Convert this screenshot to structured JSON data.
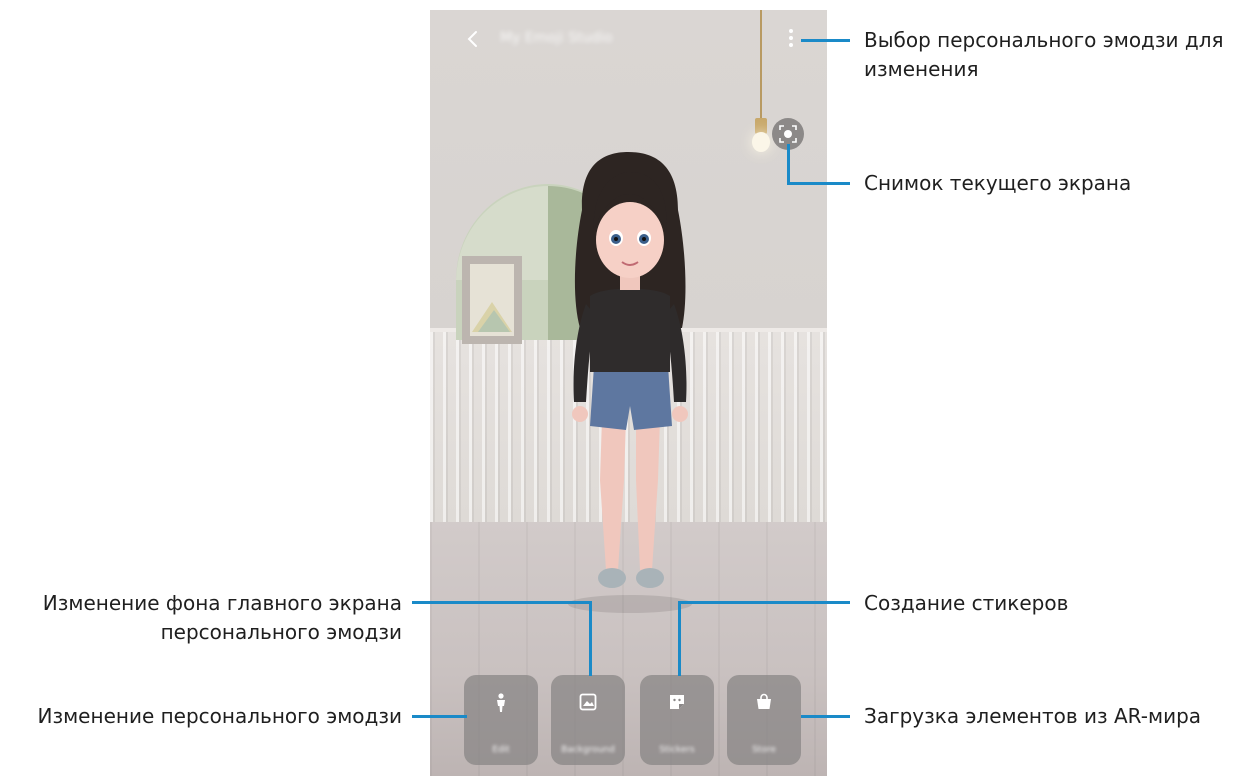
{
  "app": {
    "title": "My Emoji Studio"
  },
  "toolbar": {
    "back_icon": "chevron-left-icon",
    "more_icon": "more-vertical-icon",
    "capture_icon": "capture-screen-icon"
  },
  "menu": {
    "items": [
      {
        "label": "Edit",
        "icon": "person-icon"
      },
      {
        "label": "Background",
        "icon": "image-icon"
      },
      {
        "label": "Stickers",
        "icon": "sticker-icon"
      },
      {
        "label": "Store",
        "icon": "shopping-bag-icon"
      }
    ]
  },
  "callouts": {
    "select_emoji_line1": "Выбор персонального эмодзи для",
    "select_emoji_line2": "изменения",
    "capture": "Снимок текущего экрана",
    "background_line1": "Изменение фона главного экрана",
    "background_line2": "персонального эмодзи",
    "stickers": "Создание стикеров",
    "edit": "Изменение персонального эмодзи",
    "download": "Загрузка элементов из AR-мира"
  },
  "colors": {
    "callout_line": "#1a8ac8",
    "menu_button": "#868383",
    "wall": "#d8d4d1",
    "mirror_green": "#a9b89a"
  }
}
